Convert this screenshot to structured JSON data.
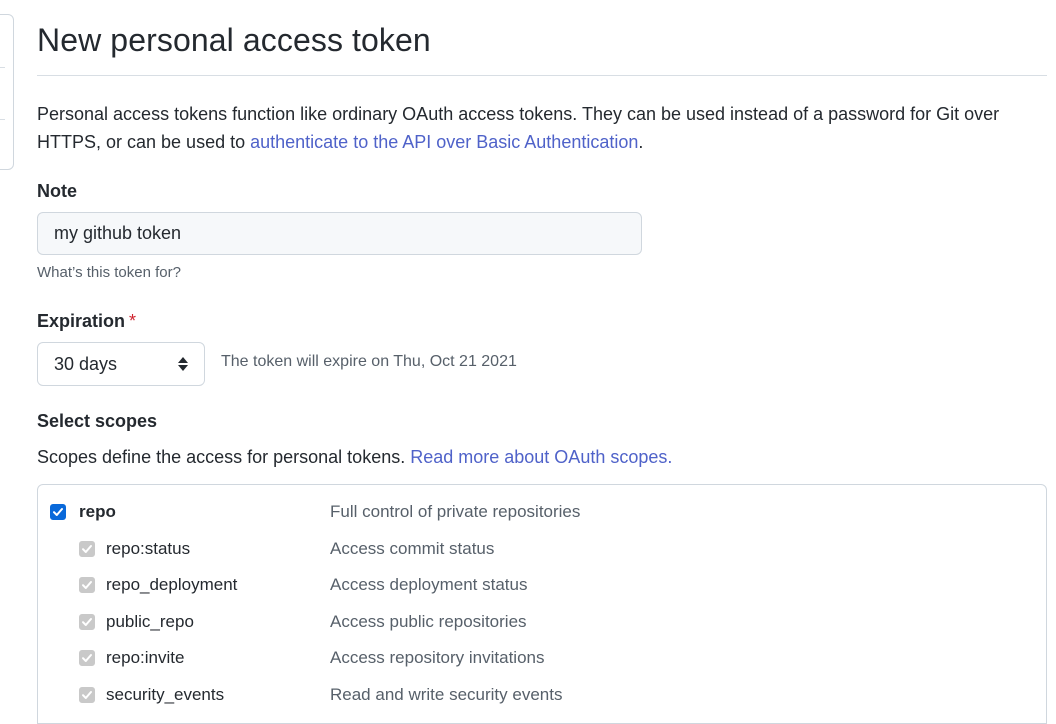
{
  "page": {
    "title": "New personal access token",
    "intro_text": "Personal access tokens function like ordinary OAuth access tokens. They can be used instead of a password for Git over HTTPS, or can be used to ",
    "intro_link": "authenticate to the API over Basic Authentication",
    "intro_end": "."
  },
  "note": {
    "label": "Note",
    "value": "my github token",
    "hint": "What’s this token for?"
  },
  "expiration": {
    "label": "Expiration",
    "required_mark": "*",
    "selected": "30 days",
    "info": "The token will expire on Thu, Oct 21 2021"
  },
  "scopes": {
    "label": "Select scopes",
    "desc_text": "Scopes define the access for personal tokens. ",
    "desc_link": "Read more about OAuth scopes.",
    "items": [
      {
        "name": "repo",
        "description": "Full control of private repositories",
        "checked": true,
        "parent": true
      },
      {
        "name": "repo:status",
        "description": "Access commit status",
        "checked": true,
        "parent": false
      },
      {
        "name": "repo_deployment",
        "description": "Access deployment status",
        "checked": true,
        "parent": false
      },
      {
        "name": "public_repo",
        "description": "Access public repositories",
        "checked": true,
        "parent": false
      },
      {
        "name": "repo:invite",
        "description": "Access repository invitations",
        "checked": true,
        "parent": false
      },
      {
        "name": "security_events",
        "description": "Read and write security events",
        "checked": true,
        "parent": false
      }
    ]
  },
  "colors": {
    "link": "#4f62c9",
    "checkbox_checked": "#0969da",
    "checkbox_disabled": "#c9c9c9",
    "required": "#cf222e"
  }
}
